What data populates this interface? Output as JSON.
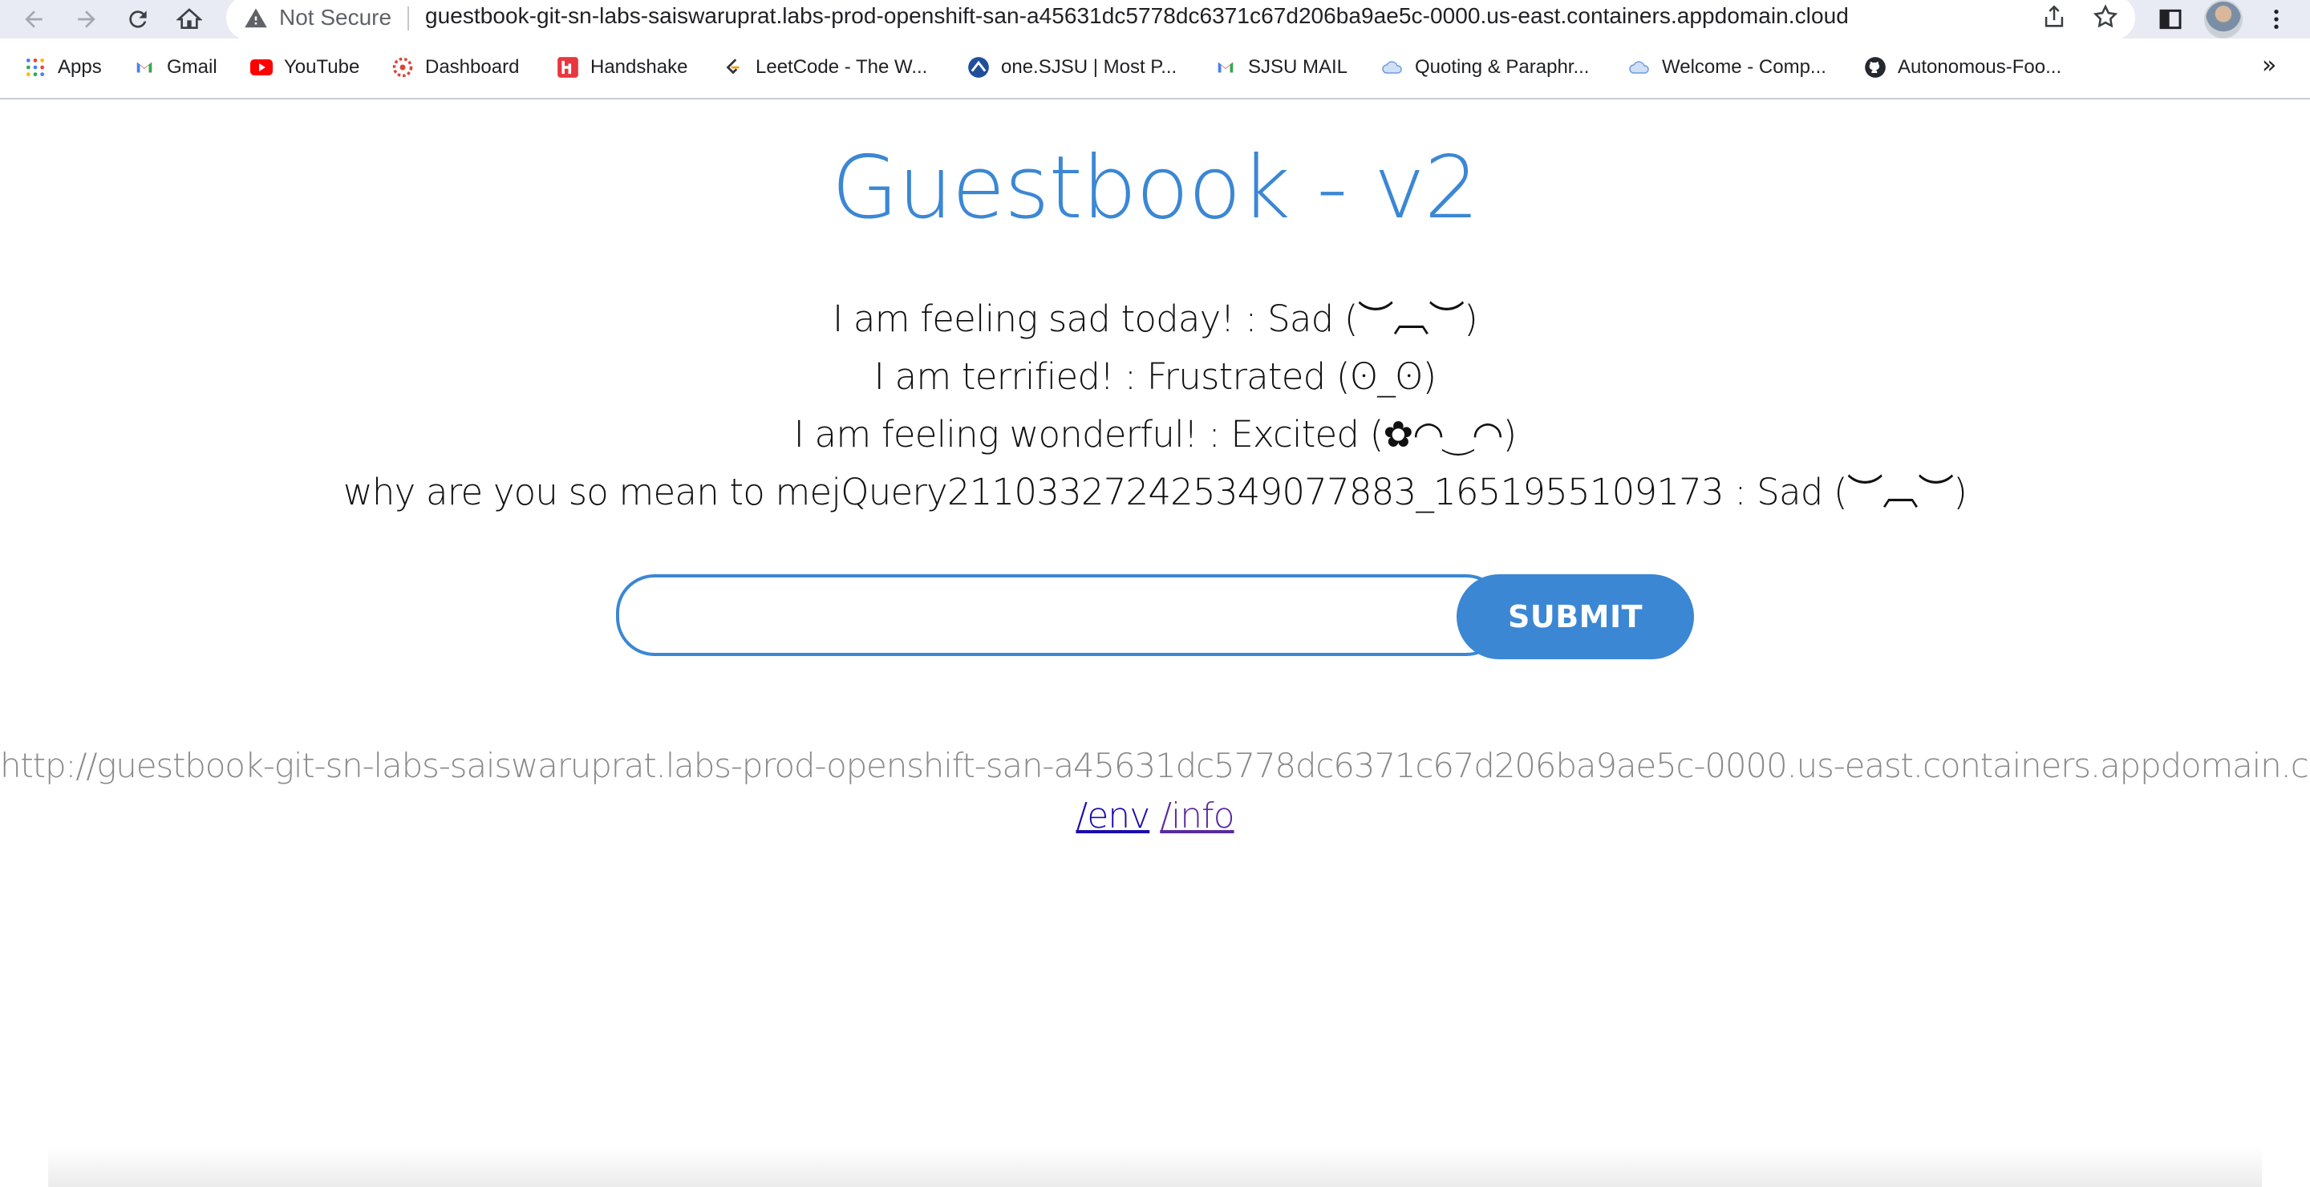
{
  "browser": {
    "omnibox": {
      "security_label": "Not Secure",
      "url": "guestbook-git-sn-labs-saiswaruprat.labs-prod-openshift-san-a45631dc5778dc6371c67d206ba9ae5c-0000.us-east.containers.appdomain.cloud"
    },
    "bookmarks": [
      {
        "label": "Apps",
        "icon": "apps-grid-icon"
      },
      {
        "label": "Gmail",
        "icon": "gmail-icon"
      },
      {
        "label": "YouTube",
        "icon": "youtube-icon"
      },
      {
        "label": "Dashboard",
        "icon": "dashboard-icon"
      },
      {
        "label": "Handshake",
        "icon": "handshake-icon"
      },
      {
        "label": "LeetCode - The W...",
        "icon": "leetcode-icon"
      },
      {
        "label": "one.SJSU | Most P...",
        "icon": "sjsu-icon"
      },
      {
        "label": "SJSU MAIL",
        "icon": "gmail-icon"
      },
      {
        "label": "Quoting & Paraphr...",
        "icon": "cloud-icon"
      },
      {
        "label": "Welcome - Comp...",
        "icon": "cloud-icon"
      },
      {
        "label": "Autonomous-Foo...",
        "icon": "github-icon"
      }
    ],
    "bookmarks_more": "»"
  },
  "page": {
    "title": "Guestbook - v2",
    "entries": [
      "I am feeling sad today! : Sad   (︶︹︶)",
      "I am terrified! : Frustrated (ʘ_ʘ)",
      "I am feeling wonderful! : Excited (✿◠‿◠)",
      "why are you so mean to mejQuery211033272425349077883_1651955109173 : Sad   (︶︹︶)"
    ],
    "input_value": "",
    "submit_label": "SUBMIT",
    "server_url": "http://guestbook-git-sn-labs-saiswaruprat.labs-prod-openshift-san-a45631dc5778dc6371c67d206ba9ae5c-0000.us-east.containers.appdomain.cloud/",
    "links": {
      "env": "/env",
      "info": "/info"
    }
  },
  "colors": {
    "accent": "#3b87d4",
    "chrome": "#e8eaf4",
    "link_visited": "#5b2a9e",
    "link": "#1a0dab"
  }
}
